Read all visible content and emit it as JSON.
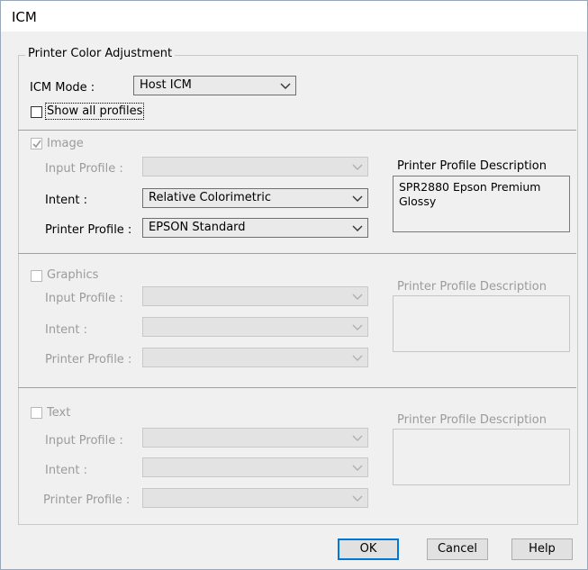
{
  "window": {
    "title": "ICM"
  },
  "group": {
    "legend": "Printer Color Adjustment"
  },
  "icm_mode": {
    "label": "ICM Mode :",
    "value": "Host ICM"
  },
  "show_all_profiles": {
    "label": "Show all profiles",
    "checked": false
  },
  "image": {
    "label": "Image",
    "checked": true,
    "input_profile": {
      "label": "Input Profile :",
      "value": ""
    },
    "intent": {
      "label": "Intent :",
      "value": "Relative Colorimetric"
    },
    "printer_profile": {
      "label": "Printer Profile :",
      "value": "EPSON Standard"
    },
    "description_label": "Printer Profile Description",
    "description": "SPR2880 Epson Premium Glossy"
  },
  "graphics": {
    "label": "Graphics",
    "checked": false,
    "input_profile": {
      "label": "Input Profile :",
      "value": ""
    },
    "intent": {
      "label": "Intent :",
      "value": ""
    },
    "printer_profile": {
      "label": "Printer Profile :",
      "value": ""
    },
    "description_label": "Printer Profile Description",
    "description": ""
  },
  "text": {
    "label": "Text",
    "checked": false,
    "input_profile": {
      "label": "Input Profile :",
      "value": ""
    },
    "intent": {
      "label": "Intent :",
      "value": ""
    },
    "printer_profile": {
      "label": "Printer Profile :",
      "value": ""
    },
    "description_label": "Printer Profile Description",
    "description": ""
  },
  "buttons": {
    "ok": "OK",
    "cancel": "Cancel",
    "help": "Help"
  },
  "icons": {
    "dropdown": "chevron-down-icon",
    "check": "checkmark-icon"
  }
}
